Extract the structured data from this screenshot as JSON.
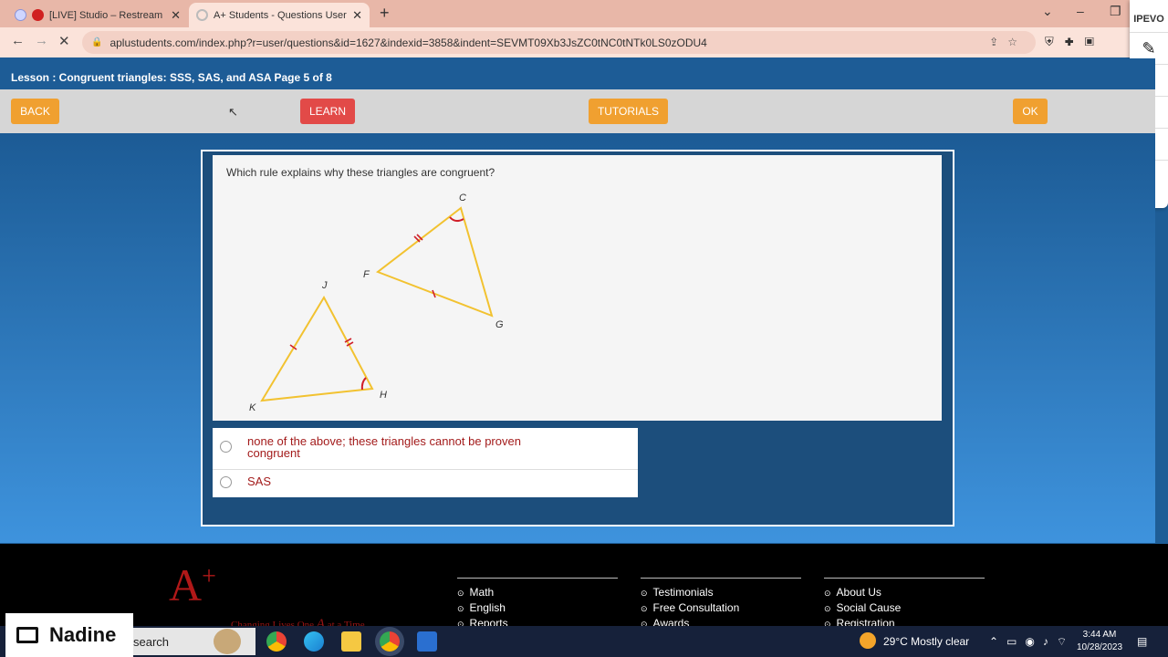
{
  "browser": {
    "tabs": [
      {
        "title": "[LIVE] Studio – Restream"
      },
      {
        "title": "A+ Students - Questions User"
      }
    ],
    "url": "aplustudents.com/index.php?r=user/questions&id=1627&indexid=3858&indent=SEVMT09Xb3JsZC0tNC0tNTk0LS0zODU4"
  },
  "ipevo": {
    "brand": "IPEVO"
  },
  "lesson": {
    "title": "Lesson : Congruent triangles: SSS, SAS, and ASA Page 5 of 8"
  },
  "buttons": {
    "back": "BACK",
    "learn": "LEARN",
    "tutorials": "TUTORIALS",
    "ok": "OK"
  },
  "question": {
    "prompt": "Which rule explains why these triangles are congruent?",
    "labels": {
      "c": "C",
      "f": "F",
      "g": "G",
      "j": "J",
      "k": "K",
      "h": "H"
    }
  },
  "answers": [
    {
      "text": "none of the above; these triangles cannot be proven congruent"
    },
    {
      "text": "SAS"
    }
  ],
  "footer": {
    "tagline": "Changing Lives One",
    "tagline_end": "at a Time",
    "col1": [
      "Math",
      "English",
      "Reports"
    ],
    "col2": [
      "Testimonials",
      "Free Consultation",
      "Awards"
    ],
    "col3": [
      "About Us",
      "Social Cause",
      "Registration"
    ]
  },
  "taskbar": {
    "user": "Nadine",
    "search": "search",
    "weather": "29°C  Mostly clear",
    "time": "3:44 AM",
    "date": "10/28/2023"
  },
  "colors": {
    "accent_orange": "#f0a030",
    "learn_red": "#e24a48",
    "triangle": "#f2c230",
    "mark_red": "#d0202a",
    "answer_text": "#a31b1b"
  }
}
